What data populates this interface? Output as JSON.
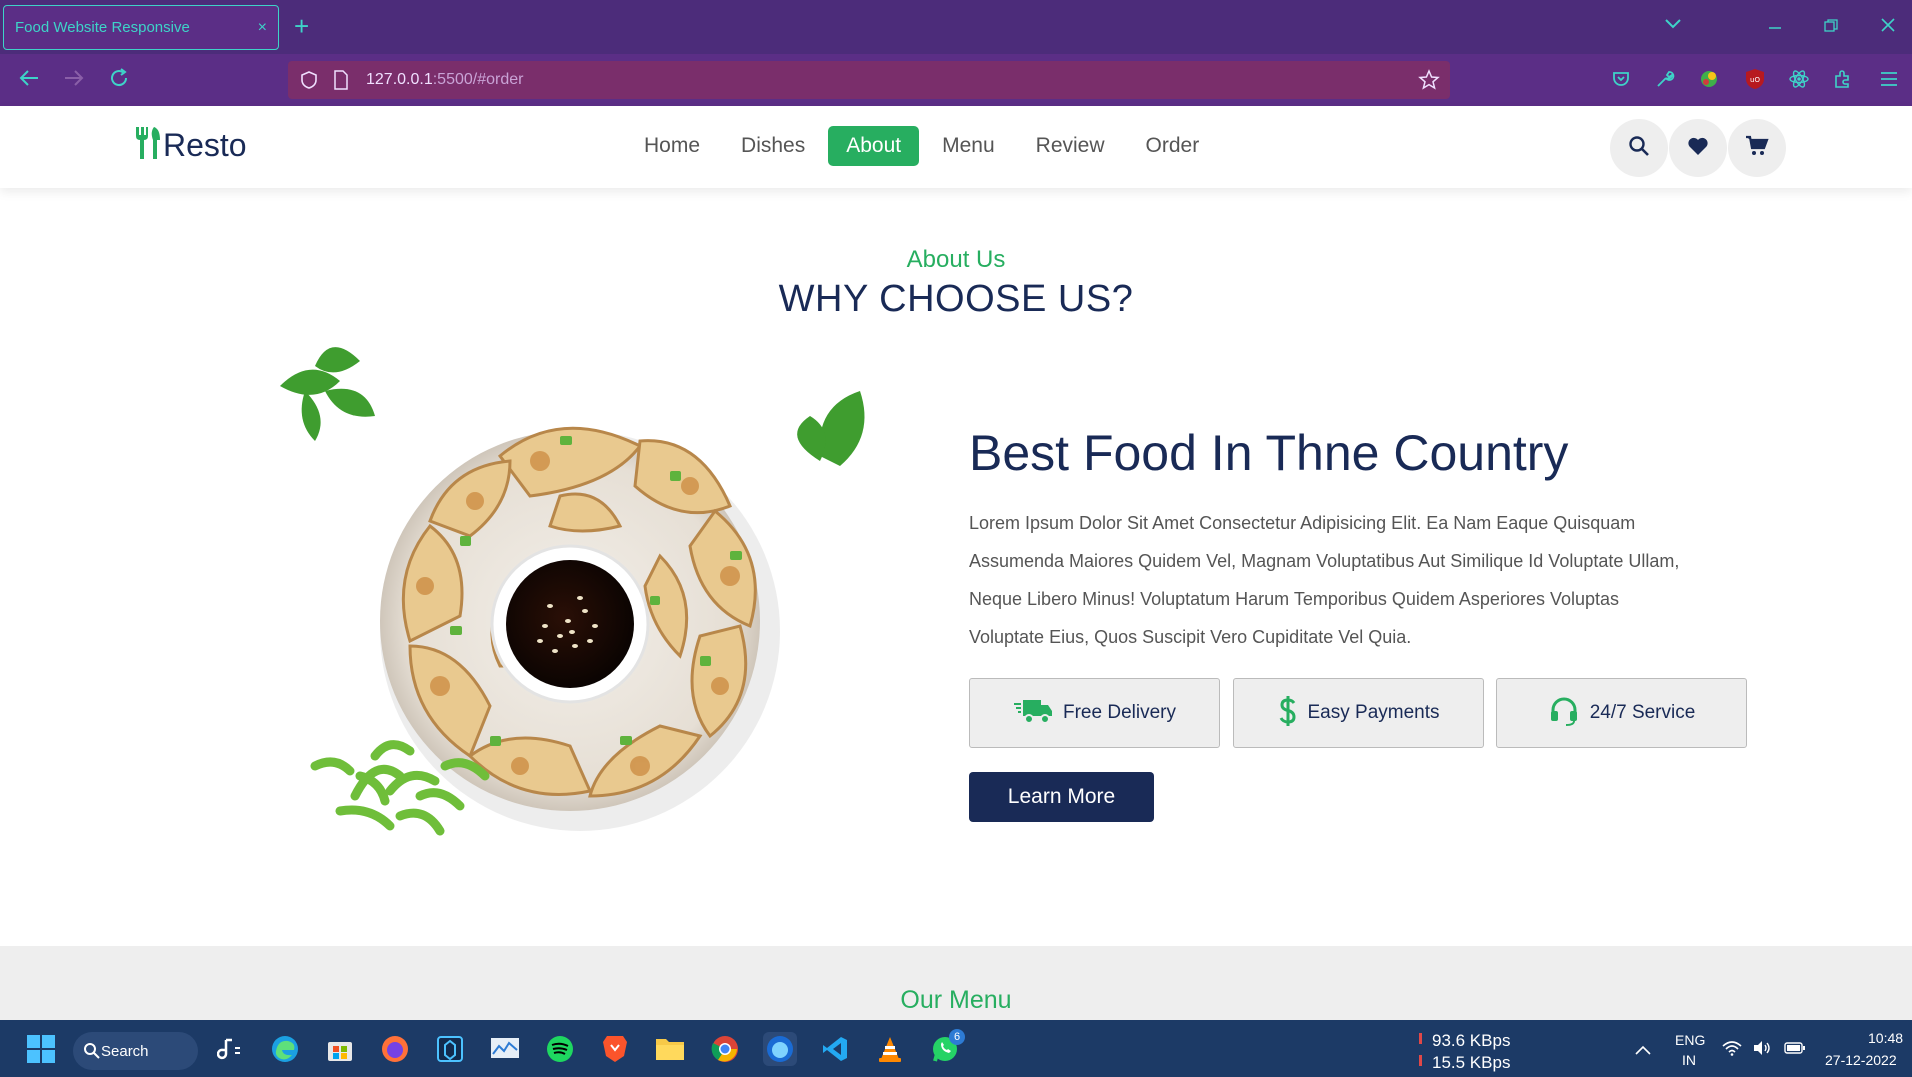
{
  "browser": {
    "tab_title": "Food Website Responsive",
    "tab_close": "×",
    "new_tab": "+",
    "url_host": "127.0.0.1",
    "url_rest": ":5500/#order"
  },
  "site": {
    "logo": "Resto",
    "nav": [
      "Home",
      "Dishes",
      "About",
      "Menu",
      "Review",
      "Order"
    ],
    "active_nav": "About"
  },
  "about": {
    "sub_heading": "About Us",
    "heading": "WHY CHOOSE US?",
    "title": "Best Food In Thne Country",
    "text_lines": [
      "Lorem Ipsum Dolor Sit Amet Consectetur Adipisicing Elit. Ea Nam Eaque Quisquam",
      "Assumenda Maiores Quidem Vel, Magnam Voluptatibus Aut Similique Id Voluptate Ullam,",
      "Neque Libero Minus! Voluptatum Harum Temporibus Quidem Asperiores Voluptas",
      "Voluptate Eius, Quos Suscipit Vero Cupiditate Vel Quia."
    ],
    "features": [
      "Free Delivery",
      "Easy Payments",
      "24/7 Service"
    ],
    "button": "Learn More"
  },
  "menu_section": {
    "sub_heading": "Our Menu"
  },
  "taskbar": {
    "search": "Search",
    "net_down": "93.6 KBps",
    "net_up": "15.5 KBps",
    "lang": "ENG",
    "region": "IN",
    "time": "10:48",
    "date": "27-12-2022",
    "whatsapp_badge": "6"
  },
  "colors": {
    "accent": "#27ae60",
    "navy": "#192a56",
    "chrome": "#4c2c7a",
    "teal": "#3ed3c8"
  }
}
